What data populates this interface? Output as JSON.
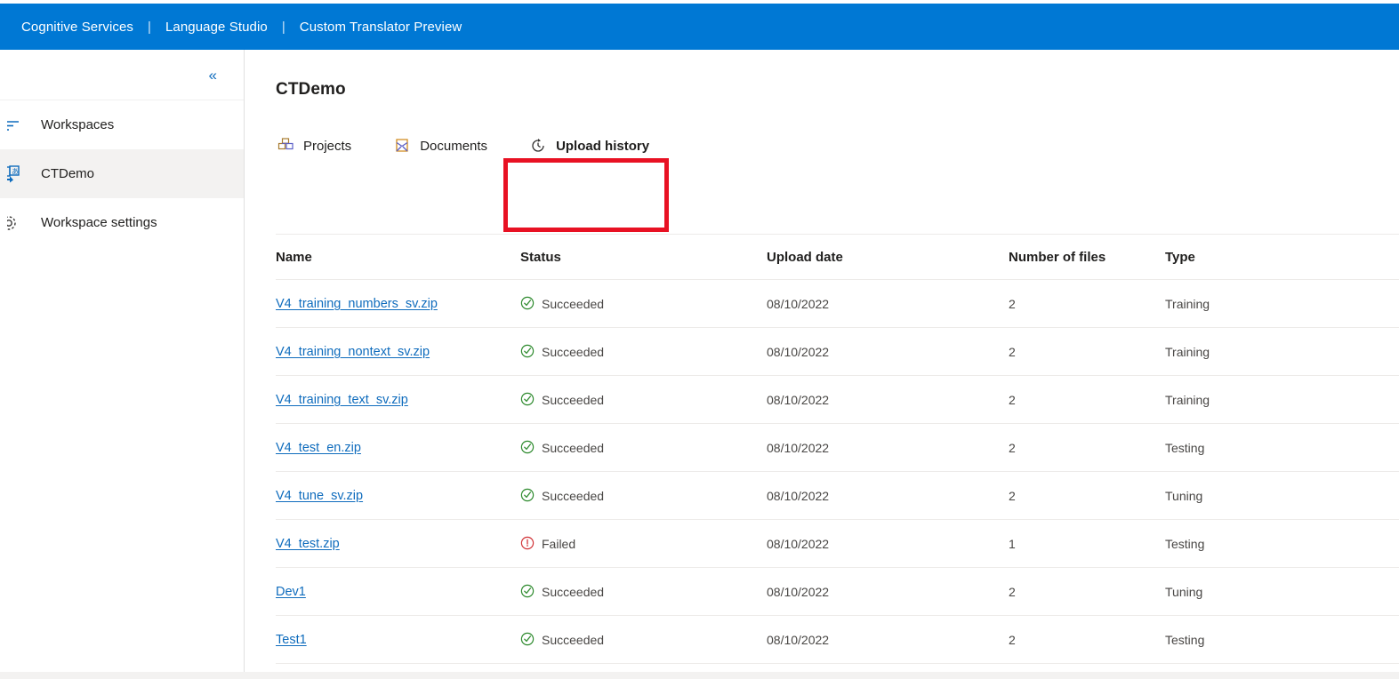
{
  "topbar": {
    "crumbs": [
      {
        "label": "Cognitive Services"
      },
      {
        "label": "Language Studio"
      },
      {
        "label": "Custom Translator Preview"
      }
    ],
    "separator": "|",
    "background_color": "#0078d4"
  },
  "sidebar": {
    "collapse_icon": "chevron-double-left-icon",
    "collapse_glyph": "«",
    "items": [
      {
        "label": "Workspaces",
        "icon": "list-icon",
        "selected": false
      },
      {
        "label": "CTDemo",
        "icon": "translate-icon",
        "selected": true
      },
      {
        "label": "Workspace settings",
        "icon": "gear-icon",
        "selected": false
      }
    ]
  },
  "main": {
    "title": "CTDemo",
    "tabs": [
      {
        "label": "Projects",
        "icon": "projects-icon",
        "active": false
      },
      {
        "label": "Documents",
        "icon": "documents-icon",
        "active": false
      },
      {
        "label": "Upload history",
        "icon": "history-clock-icon",
        "active": true
      }
    ],
    "highlight": {
      "target_tab": "Upload history",
      "color": "#e81123"
    },
    "table": {
      "columns": [
        "Name",
        "Status",
        "Upload date",
        "Number of files",
        "Type"
      ],
      "rows": [
        {
          "name": "V4_training_numbers_sv.zip",
          "status": "Succeeded",
          "status_state": "success",
          "date": "08/10/2022",
          "files": "2",
          "type": "Training"
        },
        {
          "name": "V4_training_nontext_sv.zip",
          "status": "Succeeded",
          "status_state": "success",
          "date": "08/10/2022",
          "files": "2",
          "type": "Training"
        },
        {
          "name": "V4_training_text_sv.zip",
          "status": "Succeeded",
          "status_state": "success",
          "date": "08/10/2022",
          "files": "2",
          "type": "Training"
        },
        {
          "name": "V4_test_en.zip",
          "status": "Succeeded",
          "status_state": "success",
          "date": "08/10/2022",
          "files": "2",
          "type": "Testing"
        },
        {
          "name": "V4_tune_sv.zip",
          "status": "Succeeded",
          "status_state": "success",
          "date": "08/10/2022",
          "files": "2",
          "type": "Tuning"
        },
        {
          "name": "V4_test.zip",
          "status": "Failed",
          "status_state": "error",
          "date": "08/10/2022",
          "files": "1",
          "type": "Testing"
        },
        {
          "name": "Dev1",
          "status": "Succeeded",
          "status_state": "success",
          "date": "08/10/2022",
          "files": "2",
          "type": "Tuning"
        },
        {
          "name": "Test1",
          "status": "Succeeded",
          "status_state": "success",
          "date": "08/10/2022",
          "files": "2",
          "type": "Testing"
        }
      ]
    }
  },
  "colors": {
    "brand_blue": "#0078d4",
    "link_blue": "#0f6cbd",
    "success_green": "#107c10",
    "error_red": "#d13438",
    "highlight_red": "#e81123"
  }
}
